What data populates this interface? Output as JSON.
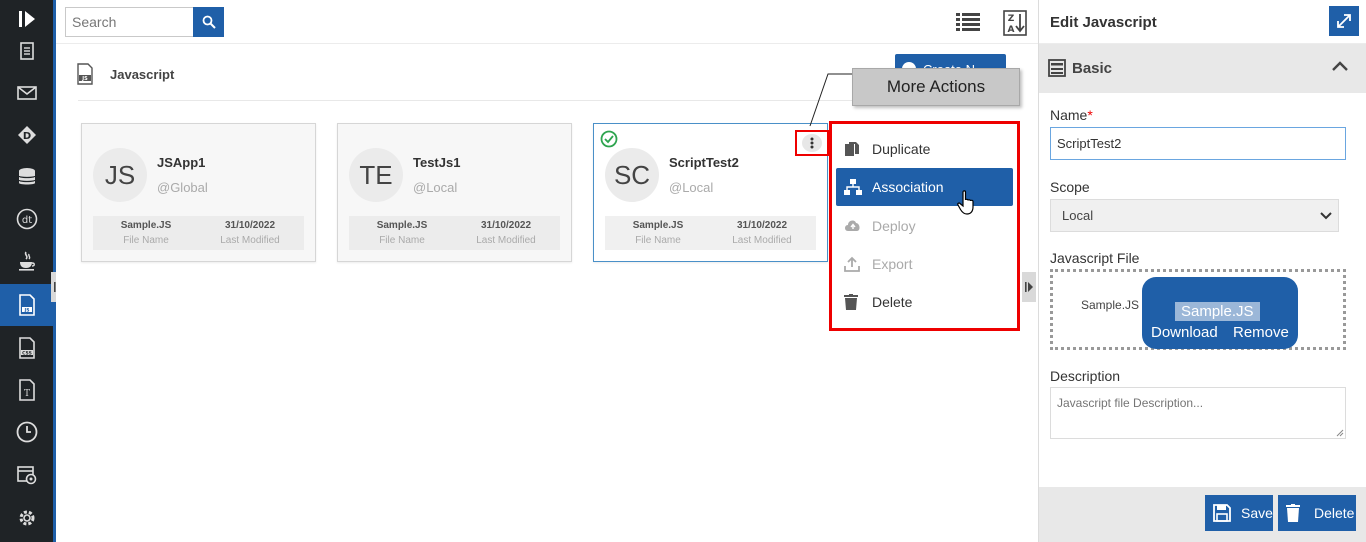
{
  "colors": {
    "accent": "#1f5fa8",
    "nav_bg": "#1f2326",
    "highlight_border": "#ee0000"
  },
  "topbar": {
    "search_placeholder": "Search"
  },
  "breadcrumb": {
    "title": "Javascript"
  },
  "create_button": {
    "label": "Create N"
  },
  "cards": [
    {
      "initials": "JS",
      "name": "JSApp1",
      "scope": "@Global",
      "file_name": "Sample.JS",
      "file_name_label": "File Name",
      "last_modified": "31/10/2022",
      "last_modified_label": "Last Modified",
      "selected": false
    },
    {
      "initials": "TE",
      "name": "TestJs1",
      "scope": "@Local",
      "file_name": "Sample.JS",
      "file_name_label": "File Name",
      "last_modified": "31/10/2022",
      "last_modified_label": "Last Modified",
      "selected": false
    },
    {
      "initials": "SC",
      "name": "ScriptTest2",
      "scope": "@Local",
      "file_name": "Sample.JS",
      "file_name_label": "File Name",
      "last_modified": "31/10/2022",
      "last_modified_label": "Last Modified",
      "selected": true
    }
  ],
  "context_menu": {
    "items": [
      {
        "label": "Duplicate",
        "icon": "duplicate-icon",
        "state": "normal"
      },
      {
        "label": "Association",
        "icon": "association-icon",
        "state": "active"
      },
      {
        "label": "Deploy",
        "icon": "cloud-upload-icon",
        "state": "disabled"
      },
      {
        "label": "Export",
        "icon": "export-icon",
        "state": "disabled"
      },
      {
        "label": "Delete",
        "icon": "trash-icon",
        "state": "normal"
      }
    ]
  },
  "callout": {
    "label": "More Actions"
  },
  "edit_panel": {
    "title": "Edit Javascript",
    "section": "Basic",
    "name_label": "Name",
    "name_required": "*",
    "name_value": "ScriptTest2",
    "scope_label": "Scope",
    "scope_value": "Local",
    "file_label": "Javascript File",
    "file_name": "Sample.JS",
    "file_popup_name": "Sample.JS",
    "download_label": "Download",
    "remove_label": "Remove",
    "description_label": "Description",
    "description_placeholder": "Javascript file Description...",
    "save_label": "Save",
    "delete_label": "Delete"
  }
}
